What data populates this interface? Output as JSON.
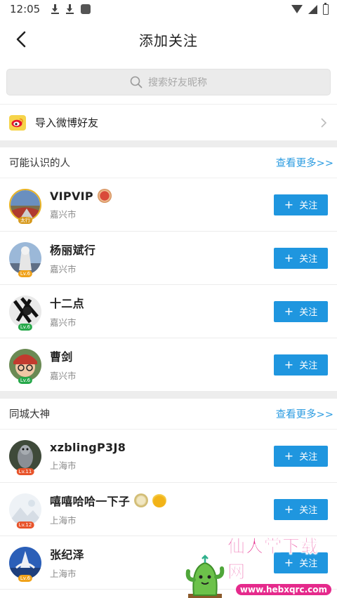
{
  "status_bar": {
    "time": "12:05"
  },
  "nav": {
    "title": "添加关注"
  },
  "search": {
    "placeholder": "搜索好友昵称"
  },
  "import_row": {
    "label": "导入微博好友"
  },
  "sections": [
    {
      "title": "可能认识的人",
      "more": "查看更多>>",
      "users": [
        {
          "name": "VIPVIP",
          "city": "嘉兴市",
          "badge": "太行",
          "badge_color": "#d79a1e",
          "follow": "关注"
        },
        {
          "name": "杨丽斌行",
          "city": "嘉兴市",
          "badge": "Lv.6",
          "badge_color": "#f0a21a",
          "follow": "关注"
        },
        {
          "name": "十二点",
          "city": "嘉兴市",
          "badge": "Lv.6",
          "badge_color": "#27a84a",
          "follow": "关注"
        },
        {
          "name": "曹剑",
          "city": "嘉兴市",
          "badge": "Lv.6",
          "badge_color": "#27a84a",
          "follow": "关注"
        }
      ]
    },
    {
      "title": "同城大神",
      "more": "查看更多>>",
      "users": [
        {
          "name": "xzblingP3J8",
          "city": "上海市",
          "badge": "Lv.11",
          "badge_color": "#e8532a",
          "follow": "关注"
        },
        {
          "name": "嘻嘻哈哈一下子",
          "city": "上海市",
          "badge": "Lv.12",
          "badge_color": "#e8532a",
          "follow": "关注"
        },
        {
          "name": "张纪泽",
          "city": "上海市",
          "badge": "Lv.6",
          "badge_color": "#f0a21a",
          "follow": "关注"
        }
      ]
    }
  ],
  "watermark": {
    "title": "仙人掌下载网",
    "url": "www.hebxqrc.com"
  },
  "colors": {
    "accent": "#1f96df",
    "more_link": "#2a9be0",
    "separator": "#ededed"
  }
}
